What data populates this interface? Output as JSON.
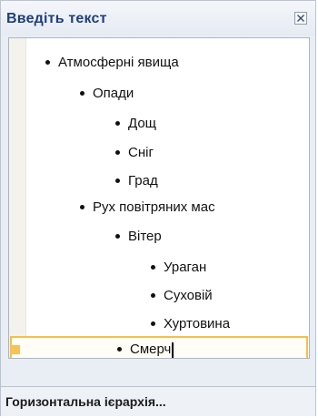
{
  "panel": {
    "title": "Введіть текст",
    "close_icon": "close-icon"
  },
  "items": [
    {
      "label": "Атмосферні явища",
      "level": 1
    },
    {
      "label": "Опади",
      "level": 2
    },
    {
      "label": "Дощ",
      "level": 3
    },
    {
      "label": "Сніг",
      "level": 3
    },
    {
      "label": "Град",
      "level": 3
    },
    {
      "label": "Рух повітряних мас",
      "level": 2
    },
    {
      "label": "Вітер",
      "level": 3
    },
    {
      "label": "Ураган",
      "level": 4
    },
    {
      "label": "Суховій",
      "level": 4
    },
    {
      "label": "Хуртовина",
      "level": 4
    },
    {
      "label": "Смерч",
      "level": 3,
      "active": true
    }
  ],
  "footer": {
    "link": "Горизонтальна ієрархія..."
  },
  "colors": {
    "title": "#1f3f7a",
    "active_border": "#f2c14a"
  }
}
